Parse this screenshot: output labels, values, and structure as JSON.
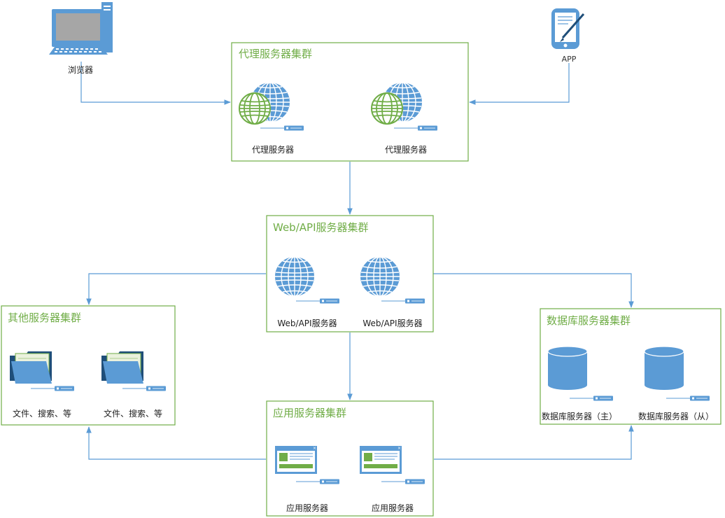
{
  "clients": {
    "browser": {
      "label": "浏览器",
      "icon": "desktop-computer-icon"
    },
    "app": {
      "label": "APP",
      "icon": "mobile-device-icon"
    }
  },
  "clusters": {
    "proxy": {
      "title": "代理服务器集群",
      "servers": [
        {
          "label": "代理服务器",
          "icon": "proxy-globe-icon"
        },
        {
          "label": "代理服务器",
          "icon": "proxy-globe-icon"
        }
      ]
    },
    "web": {
      "title": "Web/API服务器集群",
      "servers": [
        {
          "label": "Web/API服务器",
          "icon": "web-globe-icon"
        },
        {
          "label": "Web/API服务器",
          "icon": "web-globe-icon"
        }
      ]
    },
    "other": {
      "title": "其他服务器集群",
      "servers": [
        {
          "label": "文件、搜索、等",
          "icon": "folder-icon"
        },
        {
          "label": "文件、搜索、等",
          "icon": "folder-icon"
        }
      ]
    },
    "app": {
      "title": "应用服务器集群",
      "servers": [
        {
          "label": "应用服务器",
          "icon": "app-window-icon"
        },
        {
          "label": "应用服务器",
          "icon": "app-window-icon"
        }
      ]
    },
    "db": {
      "title": "数据库服务器集群",
      "servers": [
        {
          "label": "数据库服务器（主）",
          "icon": "database-cylinder-icon"
        },
        {
          "label": "数据库服务器（从）",
          "icon": "database-cylinder-icon"
        }
      ]
    }
  },
  "colors": {
    "cluster_border": "#70ad47",
    "cluster_title": "#70ad47",
    "connector": "#5b9bd5",
    "icon_blue": "#5b9bd5",
    "icon_green": "#70ad47"
  }
}
